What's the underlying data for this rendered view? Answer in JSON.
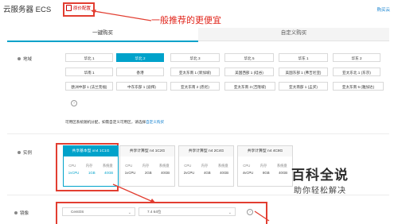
{
  "header": {
    "app_title": "云服务器 ECS",
    "badge": "原价配置",
    "top_link": "购买云"
  },
  "annotation": "一般推荐的更便宜",
  "tabs": [
    {
      "label": "一键购买",
      "active": true
    },
    {
      "label": "自定义购买",
      "active": false
    }
  ],
  "region_section": {
    "label": "地域",
    "regions": [
      [
        "华北 1",
        "华北 2",
        "华北 3",
        "华北 5",
        "华东 1",
        "华东 2"
      ],
      [
        "华南 1",
        "香港",
        "亚太东南 1 (新加坡)",
        "美国西部 1 (硅谷)",
        "美国东部 1 (弗吉尼亚)",
        "亚太东北 1 (东京)"
      ],
      [
        "欧洲中部 1 (法兰克福)",
        "中东东部 1 (迪拜)",
        "亚太东南 2 (悉尼)",
        "亚太东南 3 (吉隆坡)",
        "亚太南部 1 (孟买)",
        "亚太东南 5 (雅加达)"
      ]
    ],
    "selected": "华北 2",
    "note_text": "可用区系统随机分配，如需自定义可用区，请选择",
    "note_link": "自定义购买"
  },
  "instance_section": {
    "label": "实例",
    "spec_keys": [
      "CPU",
      "内存",
      "系统盘"
    ],
    "instances": [
      {
        "name": "共享基本型 xn4 1C1G",
        "cpu": "1vCPU",
        "mem": "1GB",
        "disk": "40GB",
        "selected": true
      },
      {
        "name": "共享计算型 n4 1C2G",
        "cpu": "1vCPU",
        "mem": "2GB",
        "disk": "40GB",
        "selected": false
      },
      {
        "name": "共享计算型 n4 2C4G",
        "cpu": "2vCPU",
        "mem": "4GB",
        "disk": "40GB",
        "selected": false
      },
      {
        "name": "共享计算型 n4 4C8G",
        "cpu": "4vCPU",
        "mem": "8GB",
        "disk": "40GB",
        "selected": false
      }
    ]
  },
  "image_section": {
    "label": "镜像",
    "os": "CentOS",
    "version": "7.4 64位"
  },
  "watermark": {
    "title": "百科全说",
    "subtitle": "助你轻松解决"
  },
  "colors": {
    "accent": "#00a2ca",
    "annotation": "#e23e31",
    "link": "#0f7fcf"
  }
}
